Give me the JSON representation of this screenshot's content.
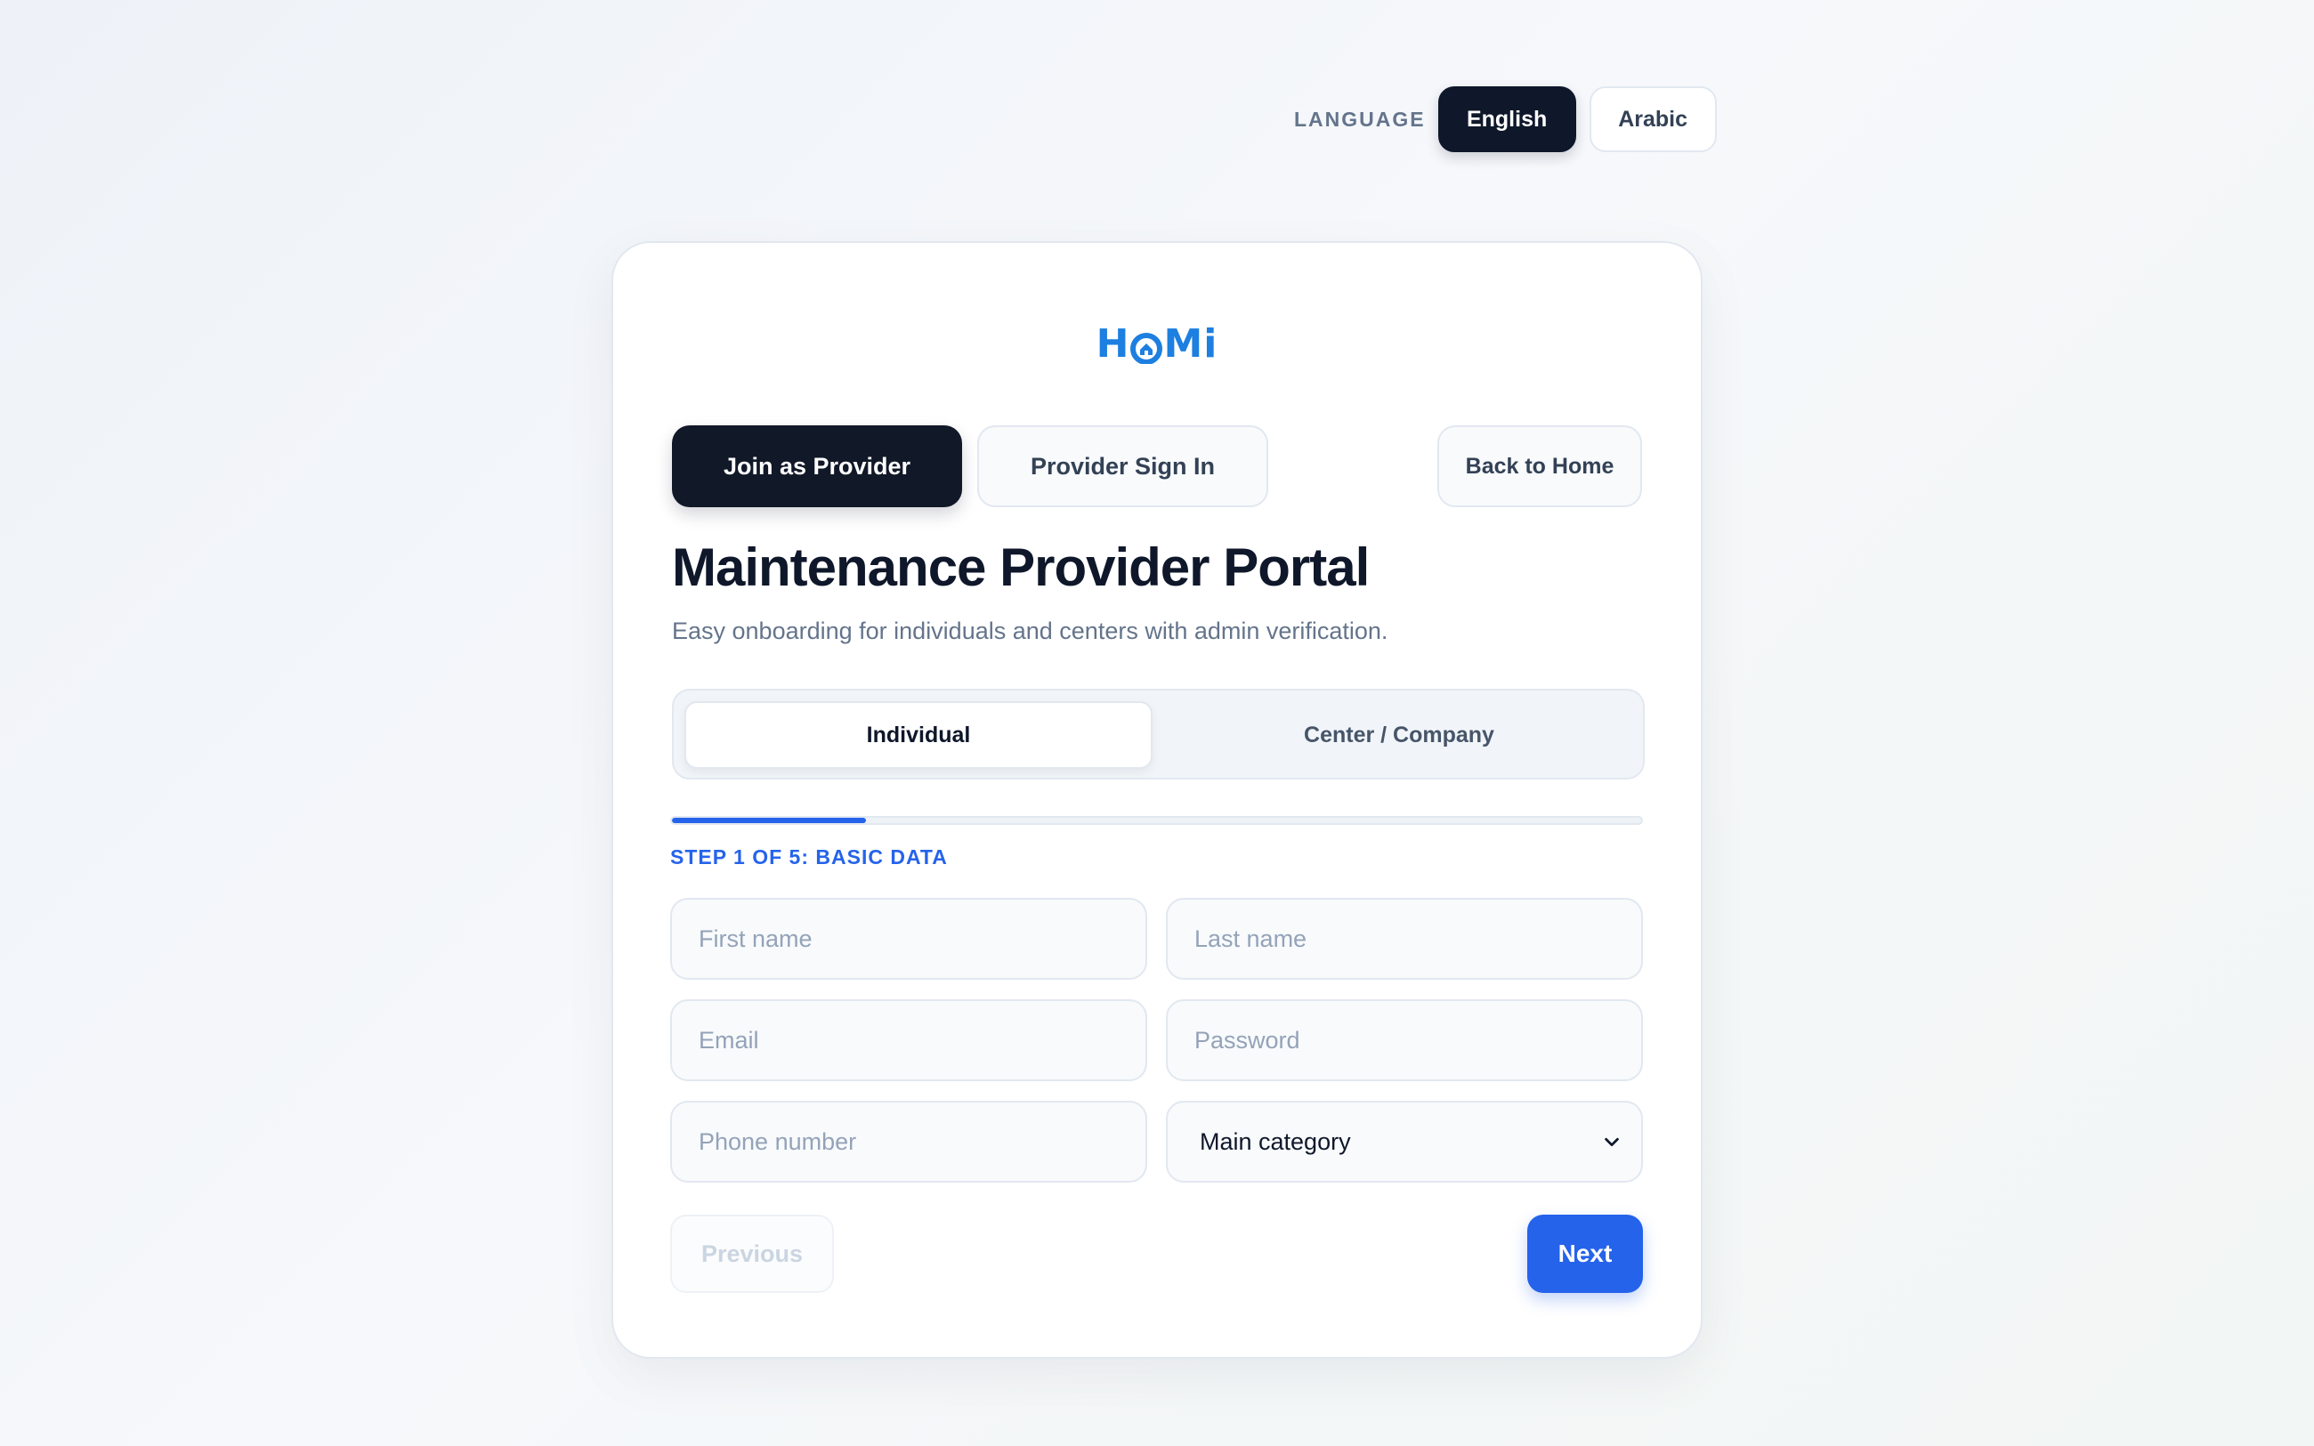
{
  "language": {
    "label": "LANGUAGE",
    "options": [
      "English",
      "Arabic"
    ],
    "selected": "English"
  },
  "brand": {
    "logo_left": "H",
    "logo_right": "Mi",
    "color": "#1d7fe0"
  },
  "nav": {
    "join_label": "Join as Provider",
    "signin_label": "Provider Sign In",
    "back_label": "Back to Home"
  },
  "header": {
    "title": "Maintenance Provider Portal",
    "subtitle": "Easy onboarding for individuals and centers with admin verification."
  },
  "account_type": {
    "options": [
      "Individual",
      "Center / Company"
    ],
    "selected": "Individual"
  },
  "progress": {
    "current_step": 1,
    "total_steps": 5,
    "fraction": 0.2,
    "label": "STEP 1 OF 5: BASIC DATA"
  },
  "form": {
    "first_name": {
      "value": "",
      "placeholder": "First name"
    },
    "last_name": {
      "value": "",
      "placeholder": "Last name"
    },
    "email": {
      "value": "",
      "placeholder": "Email"
    },
    "password": {
      "value": "",
      "placeholder": "Password"
    },
    "phone": {
      "value": "",
      "placeholder": "Phone number"
    },
    "category": {
      "selected": "Main category"
    }
  },
  "actions": {
    "previous_label": "Previous",
    "next_label": "Next"
  },
  "colors": {
    "primary": "#2563eb",
    "dark": "#111827",
    "brand": "#1d7fe0"
  }
}
